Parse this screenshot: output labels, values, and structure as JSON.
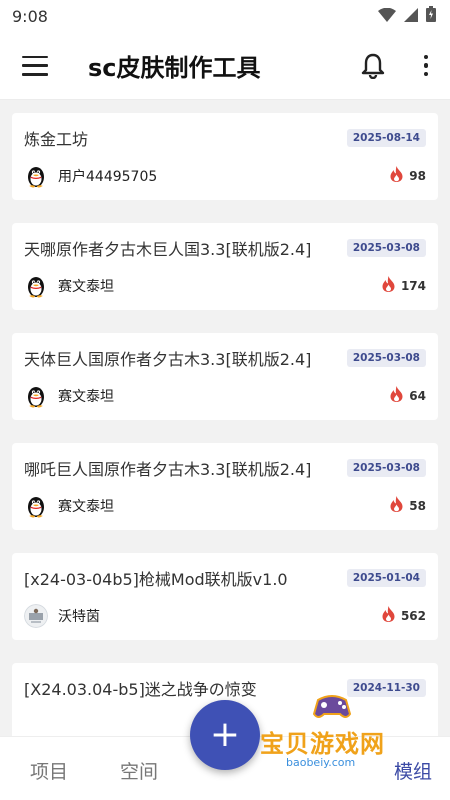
{
  "status": {
    "time": "9:08"
  },
  "app_bar": {
    "title": "sc皮肤制作工具"
  },
  "cards": [
    {
      "title": "炼金工坊",
      "date": "2025-08-14",
      "author": "用户44495705",
      "count": "98",
      "avatar": "penguin"
    },
    {
      "title": "天哪原作者夕古木巨人国3.3[联机版2.4]",
      "date": "2025-03-08",
      "author": "赛文泰坦",
      "count": "174",
      "avatar": "penguin"
    },
    {
      "title": "天体巨人国原作者夕古木3.3[联机版2.4]",
      "date": "2025-03-08",
      "author": "赛文泰坦",
      "count": "64",
      "avatar": "penguin"
    },
    {
      "title": "哪吒巨人国原作者夕古木3.3[联机版2.4]",
      "date": "2025-03-08",
      "author": "赛文泰坦",
      "count": "58",
      "avatar": "penguin"
    },
    {
      "title": "[x24-03-04b5]枪械Mod联机版v1.0",
      "date": "2025-01-04",
      "author": "沃特茵",
      "count": "562",
      "avatar": "photo"
    },
    {
      "title": "[X24.03.04-b5]迷之战争の惊变",
      "date": "2024-11-30",
      "author": "",
      "count": "",
      "avatar": ""
    }
  ],
  "bottom_nav": {
    "projects": "项目",
    "space": "空间",
    "fab": "+",
    "mod": "模组"
  },
  "watermark": {
    "text": "宝贝游戏网",
    "sub": "baobeiy.com"
  },
  "colors": {
    "accent": "#3f51b5",
    "fire": "#e0473c",
    "badge_bg": "#e9ebf3",
    "badge_text": "#3e4b8e"
  }
}
